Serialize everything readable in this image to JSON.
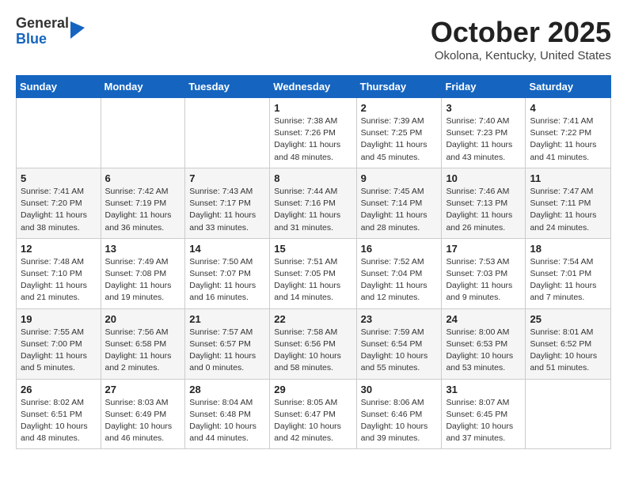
{
  "header": {
    "logo_general": "General",
    "logo_blue": "Blue",
    "month_title": "October 2025",
    "location": "Okolona, Kentucky, United States"
  },
  "calendar": {
    "weekdays": [
      "Sunday",
      "Monday",
      "Tuesday",
      "Wednesday",
      "Thursday",
      "Friday",
      "Saturday"
    ],
    "weeks": [
      [
        {
          "day": "",
          "info": ""
        },
        {
          "day": "",
          "info": ""
        },
        {
          "day": "",
          "info": ""
        },
        {
          "day": "1",
          "info": "Sunrise: 7:38 AM\nSunset: 7:26 PM\nDaylight: 11 hours\nand 48 minutes."
        },
        {
          "day": "2",
          "info": "Sunrise: 7:39 AM\nSunset: 7:25 PM\nDaylight: 11 hours\nand 45 minutes."
        },
        {
          "day": "3",
          "info": "Sunrise: 7:40 AM\nSunset: 7:23 PM\nDaylight: 11 hours\nand 43 minutes."
        },
        {
          "day": "4",
          "info": "Sunrise: 7:41 AM\nSunset: 7:22 PM\nDaylight: 11 hours\nand 41 minutes."
        }
      ],
      [
        {
          "day": "5",
          "info": "Sunrise: 7:41 AM\nSunset: 7:20 PM\nDaylight: 11 hours\nand 38 minutes."
        },
        {
          "day": "6",
          "info": "Sunrise: 7:42 AM\nSunset: 7:19 PM\nDaylight: 11 hours\nand 36 minutes."
        },
        {
          "day": "7",
          "info": "Sunrise: 7:43 AM\nSunset: 7:17 PM\nDaylight: 11 hours\nand 33 minutes."
        },
        {
          "day": "8",
          "info": "Sunrise: 7:44 AM\nSunset: 7:16 PM\nDaylight: 11 hours\nand 31 minutes."
        },
        {
          "day": "9",
          "info": "Sunrise: 7:45 AM\nSunset: 7:14 PM\nDaylight: 11 hours\nand 28 minutes."
        },
        {
          "day": "10",
          "info": "Sunrise: 7:46 AM\nSunset: 7:13 PM\nDaylight: 11 hours\nand 26 minutes."
        },
        {
          "day": "11",
          "info": "Sunrise: 7:47 AM\nSunset: 7:11 PM\nDaylight: 11 hours\nand 24 minutes."
        }
      ],
      [
        {
          "day": "12",
          "info": "Sunrise: 7:48 AM\nSunset: 7:10 PM\nDaylight: 11 hours\nand 21 minutes."
        },
        {
          "day": "13",
          "info": "Sunrise: 7:49 AM\nSunset: 7:08 PM\nDaylight: 11 hours\nand 19 minutes."
        },
        {
          "day": "14",
          "info": "Sunrise: 7:50 AM\nSunset: 7:07 PM\nDaylight: 11 hours\nand 16 minutes."
        },
        {
          "day": "15",
          "info": "Sunrise: 7:51 AM\nSunset: 7:05 PM\nDaylight: 11 hours\nand 14 minutes."
        },
        {
          "day": "16",
          "info": "Sunrise: 7:52 AM\nSunset: 7:04 PM\nDaylight: 11 hours\nand 12 minutes."
        },
        {
          "day": "17",
          "info": "Sunrise: 7:53 AM\nSunset: 7:03 PM\nDaylight: 11 hours\nand 9 minutes."
        },
        {
          "day": "18",
          "info": "Sunrise: 7:54 AM\nSunset: 7:01 PM\nDaylight: 11 hours\nand 7 minutes."
        }
      ],
      [
        {
          "day": "19",
          "info": "Sunrise: 7:55 AM\nSunset: 7:00 PM\nDaylight: 11 hours\nand 5 minutes."
        },
        {
          "day": "20",
          "info": "Sunrise: 7:56 AM\nSunset: 6:58 PM\nDaylight: 11 hours\nand 2 minutes."
        },
        {
          "day": "21",
          "info": "Sunrise: 7:57 AM\nSunset: 6:57 PM\nDaylight: 11 hours\nand 0 minutes."
        },
        {
          "day": "22",
          "info": "Sunrise: 7:58 AM\nSunset: 6:56 PM\nDaylight: 10 hours\nand 58 minutes."
        },
        {
          "day": "23",
          "info": "Sunrise: 7:59 AM\nSunset: 6:54 PM\nDaylight: 10 hours\nand 55 minutes."
        },
        {
          "day": "24",
          "info": "Sunrise: 8:00 AM\nSunset: 6:53 PM\nDaylight: 10 hours\nand 53 minutes."
        },
        {
          "day": "25",
          "info": "Sunrise: 8:01 AM\nSunset: 6:52 PM\nDaylight: 10 hours\nand 51 minutes."
        }
      ],
      [
        {
          "day": "26",
          "info": "Sunrise: 8:02 AM\nSunset: 6:51 PM\nDaylight: 10 hours\nand 48 minutes."
        },
        {
          "day": "27",
          "info": "Sunrise: 8:03 AM\nSunset: 6:49 PM\nDaylight: 10 hours\nand 46 minutes."
        },
        {
          "day": "28",
          "info": "Sunrise: 8:04 AM\nSunset: 6:48 PM\nDaylight: 10 hours\nand 44 minutes."
        },
        {
          "day": "29",
          "info": "Sunrise: 8:05 AM\nSunset: 6:47 PM\nDaylight: 10 hours\nand 42 minutes."
        },
        {
          "day": "30",
          "info": "Sunrise: 8:06 AM\nSunset: 6:46 PM\nDaylight: 10 hours\nand 39 minutes."
        },
        {
          "day": "31",
          "info": "Sunrise: 8:07 AM\nSunset: 6:45 PM\nDaylight: 10 hours\nand 37 minutes."
        },
        {
          "day": "",
          "info": ""
        }
      ]
    ]
  }
}
